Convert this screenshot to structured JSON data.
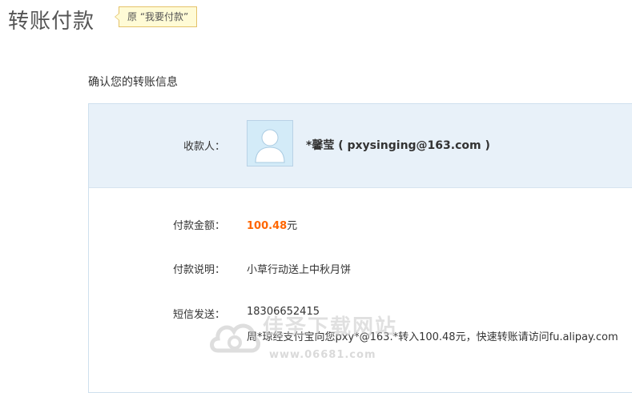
{
  "page": {
    "title": "转账付款",
    "tip_badge": "原 “我要付款”",
    "section_heading": "确认您的转账信息"
  },
  "payee": {
    "label": "收款人：",
    "name": "*馨莹 ( pxysinging@163.com )",
    "avatar_icon": "default-user-avatar-icon"
  },
  "amount": {
    "label": "付款金额：",
    "number": "100.48",
    "unit": "元"
  },
  "memo": {
    "label": "付款说明：",
    "value": "小草行动送上中秋月饼"
  },
  "sms": {
    "label": "短信发送：",
    "phone": "18306652415",
    "content": "周*琼经支付宝向您pxy*@163.*转入100.48元，快速转账请访问fu.alipay.com"
  },
  "watermark": {
    "text": "佳圣下载网站",
    "url": "www.06681.com"
  },
  "colors": {
    "accent_amount": "#ff6600",
    "panel_band": "#e8f1f9",
    "panel_border": "#cfe0ee",
    "tip_bg": "#fffbd6"
  }
}
